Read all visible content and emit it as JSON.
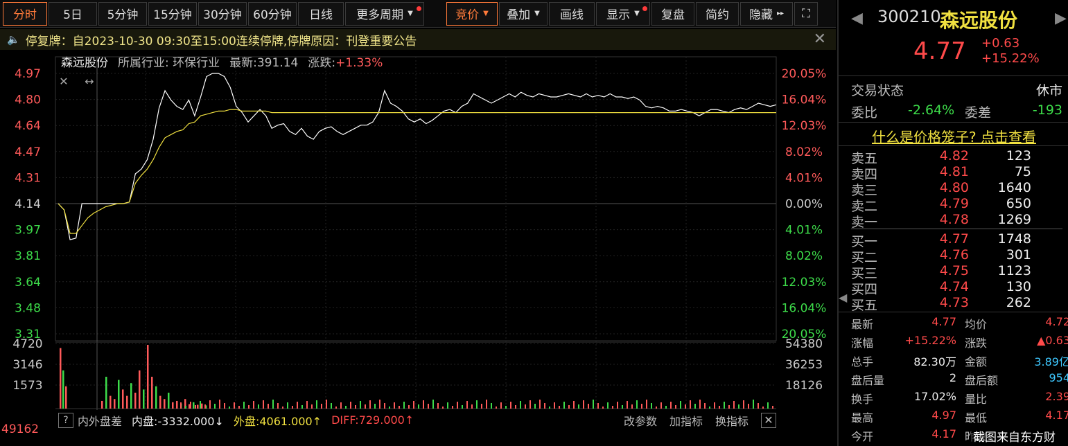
{
  "toolbar": {
    "items": [
      {
        "label": "分时",
        "active": true
      },
      {
        "label": "5日"
      },
      {
        "label": "5分钟"
      },
      {
        "label": "15分钟"
      },
      {
        "label": "30分钟"
      },
      {
        "label": "60分钟"
      },
      {
        "label": "日线"
      },
      {
        "label": "更多周期",
        "caret": true,
        "dot": true
      },
      {
        "label": "竞价",
        "caret": true,
        "active": true
      },
      {
        "label": "叠加",
        "caret": true
      },
      {
        "label": "画线"
      },
      {
        "label": "显示",
        "caret": true,
        "dot": true
      },
      {
        "label": "复盘"
      },
      {
        "label": "简约"
      },
      {
        "label": "隐藏"
      }
    ],
    "fullscreen_icon": "expand-icon"
  },
  "notice": {
    "text": "停复牌：自2023-10-30 09:30至15:00连续停牌,停牌原因：刊登重要公告",
    "icon": "speaker-icon"
  },
  "chart_info": {
    "name": "森远股份",
    "industry": "所属行业: 环保行业",
    "latest": "最新:391.14",
    "change_label": "涨跌:",
    "change_value": "+1.33%"
  },
  "chart_data": {
    "type": "line",
    "left_ticks": [
      "4.97",
      "4.80",
      "4.64",
      "4.47",
      "4.31",
      "4.14",
      "3.97",
      "3.81",
      "3.64",
      "3.48",
      "3.31"
    ],
    "right_ticks": [
      "20.05%",
      "16.04%",
      "12.03%",
      "8.02%",
      "4.01%",
      "0.00%",
      "4.01%",
      "8.02%",
      "12.03%",
      "16.04%",
      "20.05%"
    ],
    "ylim": [
      3.31,
      4.97
    ],
    "prev_close": 4.14,
    "volume_ticks_left": [
      "4720",
      "3146",
      "1573"
    ],
    "volume_ticks_right": [
      "54380",
      "36253",
      "18126"
    ],
    "series": [
      {
        "color": "#ffffff",
        "values": [
          4.14,
          4.1,
          3.91,
          3.92,
          4.14,
          4.14,
          4.14,
          4.14,
          4.14,
          4.14,
          4.14,
          4.14,
          4.15,
          4.33,
          4.36,
          4.42,
          4.55,
          4.75,
          4.86,
          4.8,
          4.76,
          4.74,
          4.8,
          4.7,
          4.82,
          4.95,
          4.97,
          4.97,
          4.95,
          4.88,
          4.76,
          4.72,
          4.66,
          4.7,
          4.74,
          4.7,
          4.62,
          4.64,
          4.65,
          4.6,
          4.58,
          4.62,
          4.57,
          4.55,
          4.6,
          4.62,
          4.63,
          4.6,
          4.58,
          4.6,
          4.62,
          4.64,
          4.64,
          4.66,
          4.72,
          4.86,
          4.78,
          4.76,
          4.73,
          4.68,
          4.66,
          4.68,
          4.65,
          4.67,
          4.7,
          4.73,
          4.74,
          4.72,
          4.76,
          4.78,
          4.84,
          4.82,
          4.8,
          4.78,
          4.8,
          4.82,
          4.84,
          4.82,
          4.85,
          4.83,
          4.82,
          4.84,
          4.83,
          4.82,
          4.82,
          4.83,
          4.84,
          4.83,
          4.82,
          4.84,
          4.82,
          4.83,
          4.82,
          4.84,
          4.82,
          4.82,
          4.81,
          4.82,
          4.8,
          4.76,
          4.75,
          4.76,
          4.75,
          4.73,
          4.73,
          4.74,
          4.73,
          4.72,
          4.7,
          4.72,
          4.74,
          4.74,
          4.73,
          4.72,
          4.74,
          4.75,
          4.74,
          4.76,
          4.78,
          4.77,
          4.76,
          4.77
        ]
      },
      {
        "color": "#f0e040",
        "values": [
          4.14,
          4.1,
          3.95,
          3.95,
          4.0,
          4.05,
          4.08,
          4.1,
          4.12,
          4.13,
          4.14,
          4.14,
          4.15,
          4.27,
          4.32,
          4.36,
          4.42,
          4.5,
          4.56,
          4.58,
          4.6,
          4.61,
          4.65,
          4.66,
          4.7,
          4.71,
          4.72,
          4.73,
          4.73,
          4.74,
          4.74,
          4.73,
          4.73,
          4.73,
          4.73,
          4.73,
          4.72,
          4.72,
          4.72,
          4.72,
          4.72,
          4.72,
          4.72,
          4.72,
          4.72,
          4.72,
          4.72,
          4.72,
          4.72,
          4.72,
          4.72,
          4.72,
          4.72,
          4.72,
          4.72,
          4.72,
          4.72,
          4.72,
          4.72,
          4.72,
          4.72,
          4.72,
          4.72,
          4.72,
          4.72,
          4.72,
          4.72,
          4.72,
          4.72,
          4.72,
          4.72,
          4.72,
          4.72,
          4.72,
          4.72,
          4.72,
          4.72,
          4.72,
          4.72,
          4.72,
          4.72,
          4.72,
          4.72,
          4.72,
          4.72,
          4.72,
          4.72,
          4.72,
          4.72,
          4.72,
          4.72,
          4.72,
          4.72,
          4.72,
          4.72,
          4.72,
          4.72,
          4.72,
          4.72,
          4.72,
          4.72,
          4.72,
          4.72,
          4.72,
          4.72,
          4.72,
          4.72,
          4.72,
          4.72,
          4.72,
          4.72,
          4.72,
          4.72,
          4.72,
          4.72,
          4.72,
          4.72,
          4.72,
          4.72,
          4.72,
          4.72,
          4.72
        ]
      }
    ]
  },
  "sub_toolbar": {
    "help": "?",
    "indicator": "内外盘差",
    "inner": "内盘:-3332.000↓",
    "outer": "外盘:4061.000↑",
    "diff": "DIFF:729.000↑",
    "change_params": "改参数",
    "add_indicator": "加指标",
    "switch_indicator": "换指标",
    "close": "✕"
  },
  "bottom_left_value": "49162",
  "right_panel": {
    "code": "300210",
    "name": "森远股份",
    "price": "4.77",
    "change": "+0.63",
    "change_pct": "+15.22%",
    "status_label": "交易状态",
    "status_value": "休市",
    "weibi_label": "委比",
    "weibi_value": "-2.64%",
    "weicha_label": "委差",
    "weicha_value": "-193",
    "cage_link": "什么是价格笼子? 点击查看",
    "asks": [
      {
        "label": "卖五",
        "price": "4.82",
        "vol": "123"
      },
      {
        "label": "卖四",
        "price": "4.81",
        "vol": "75"
      },
      {
        "label": "卖三",
        "price": "4.80",
        "vol": "1640"
      },
      {
        "label": "卖二",
        "price": "4.79",
        "vol": "650"
      },
      {
        "label": "卖一",
        "price": "4.78",
        "vol": "1269"
      }
    ],
    "bids": [
      {
        "label": "买一",
        "price": "4.77",
        "vol": "1748"
      },
      {
        "label": "买二",
        "price": "4.76",
        "vol": "301"
      },
      {
        "label": "买三",
        "price": "4.75",
        "vol": "1123"
      },
      {
        "label": "买四",
        "price": "4.74",
        "vol": "130"
      },
      {
        "label": "买五",
        "price": "4.73",
        "vol": "262"
      }
    ],
    "stats": [
      {
        "k": "最新",
        "v": "4.77",
        "c": "red"
      },
      {
        "k": "均价",
        "v": "4.72",
        "c": "red"
      },
      {
        "k": "涨幅",
        "v": "+15.22%",
        "c": "red"
      },
      {
        "k": "涨跌",
        "v": "▲0.63",
        "c": "red"
      },
      {
        "k": "总手",
        "v": "82.30万",
        "c": "white"
      },
      {
        "k": "金额",
        "v": "3.89亿",
        "c": "cyan"
      },
      {
        "k": "盘后量",
        "v": "2",
        "c": "white"
      },
      {
        "k": "盘后额",
        "v": "954",
        "c": "cyan"
      },
      {
        "k": "换手",
        "v": "17.02%",
        "c": "white"
      },
      {
        "k": "量比",
        "v": "2.39",
        "c": "red"
      },
      {
        "k": "最高",
        "v": "4.97",
        "c": "red"
      },
      {
        "k": "最低",
        "v": "4.17",
        "c": "red"
      },
      {
        "k": "今开",
        "v": "4.17",
        "c": "red"
      },
      {
        "k": "昨收",
        "v": "",
        "c": "white"
      }
    ]
  },
  "watermark": "截图来自东方财富"
}
